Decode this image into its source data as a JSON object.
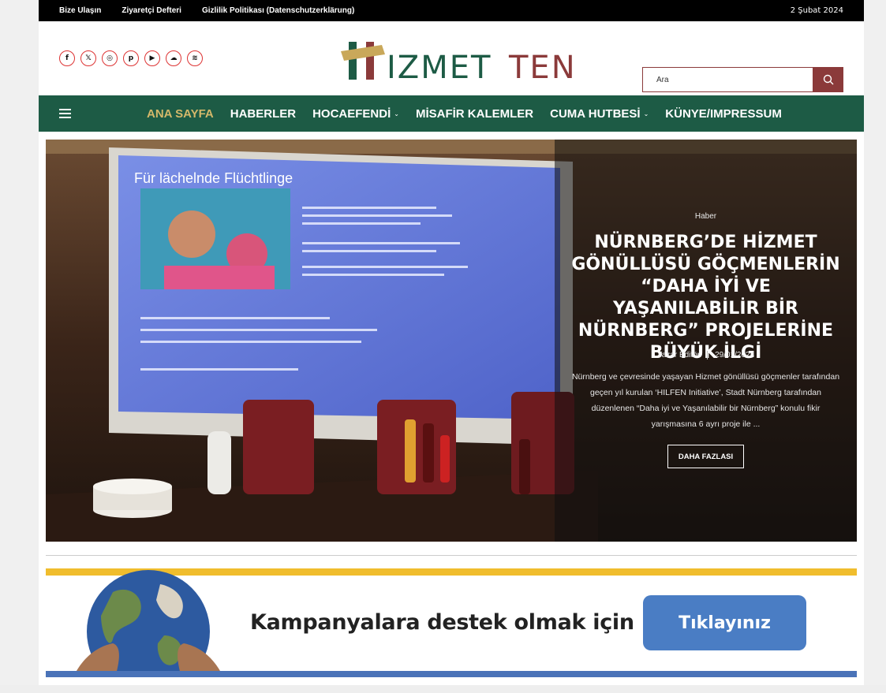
{
  "topbar": {
    "links": [
      "Bize Ulaşın",
      "Ziyaretçi Defteri",
      "Gizlilik Politikası (Datenschutzerklärung)"
    ],
    "date": "2 Şubat 2024"
  },
  "header": {
    "socials": [
      {
        "icon": "facebook-icon",
        "glyph": "f"
      },
      {
        "icon": "x-twitter-icon",
        "glyph": "𝕏"
      },
      {
        "icon": "instagram-icon",
        "glyph": "◎"
      },
      {
        "icon": "pinterest-icon",
        "glyph": "p"
      },
      {
        "icon": "youtube-icon",
        "glyph": "▶"
      },
      {
        "icon": "soundcloud-icon",
        "glyph": "☁"
      },
      {
        "icon": "spotify-icon",
        "glyph": "≋"
      }
    ],
    "logo_text": "IZMETTEN",
    "search_placeholder": "Ara"
  },
  "nav": {
    "items": [
      {
        "label": "ANA SAYFA",
        "active": true,
        "dropdown": false
      },
      {
        "label": "HABERLER",
        "active": false,
        "dropdown": false
      },
      {
        "label": "HOCAEFENDİ",
        "active": false,
        "dropdown": true
      },
      {
        "label": "MİSAFİR KALEMLER",
        "active": false,
        "dropdown": false
      },
      {
        "label": "CUMA HUTBESİ",
        "active": false,
        "dropdown": true
      },
      {
        "label": "KÜNYE/IMPRESSUM",
        "active": false,
        "dropdown": false
      }
    ]
  },
  "hero": {
    "category": "Haber",
    "title": "NÜRNBERG’DE HİZMET GÖNÜLLÜSÜ GÖÇMENLERİN “DAHA İYİ VE YAŞANILABİLİR BİR NÜRNBERG” PROJELERİNE BÜYÜK İLGİ",
    "author": "Yazar Editör",
    "date": "29/01/2024",
    "excerpt": "Nürnberg ve çevresinde yaşayan Hizmet gönüllüsü göçmenler tarafından geçen yıl kurulan ‘HILFEN Initiative’, Stadt Nürnberg tarafından düzenlenen “Daha iyi ve Yaşanılabilir bir Nürnberg” konulu fikir yarışmasına 6 ayrı proje ile ...",
    "button": "DAHA FAZLASI",
    "slide_heading": "Für lächelnde Flüchtlinge"
  },
  "banner": {
    "text": "Kampanyalara destek olmak için",
    "button": "Tıklayınız"
  },
  "colors": {
    "nav_bg": "#1d5b45",
    "nav_active": "#d4b86a",
    "accent": "#8b3a3a",
    "banner_yellow": "#f0bd2d",
    "banner_blue": "#4a7dc4"
  }
}
